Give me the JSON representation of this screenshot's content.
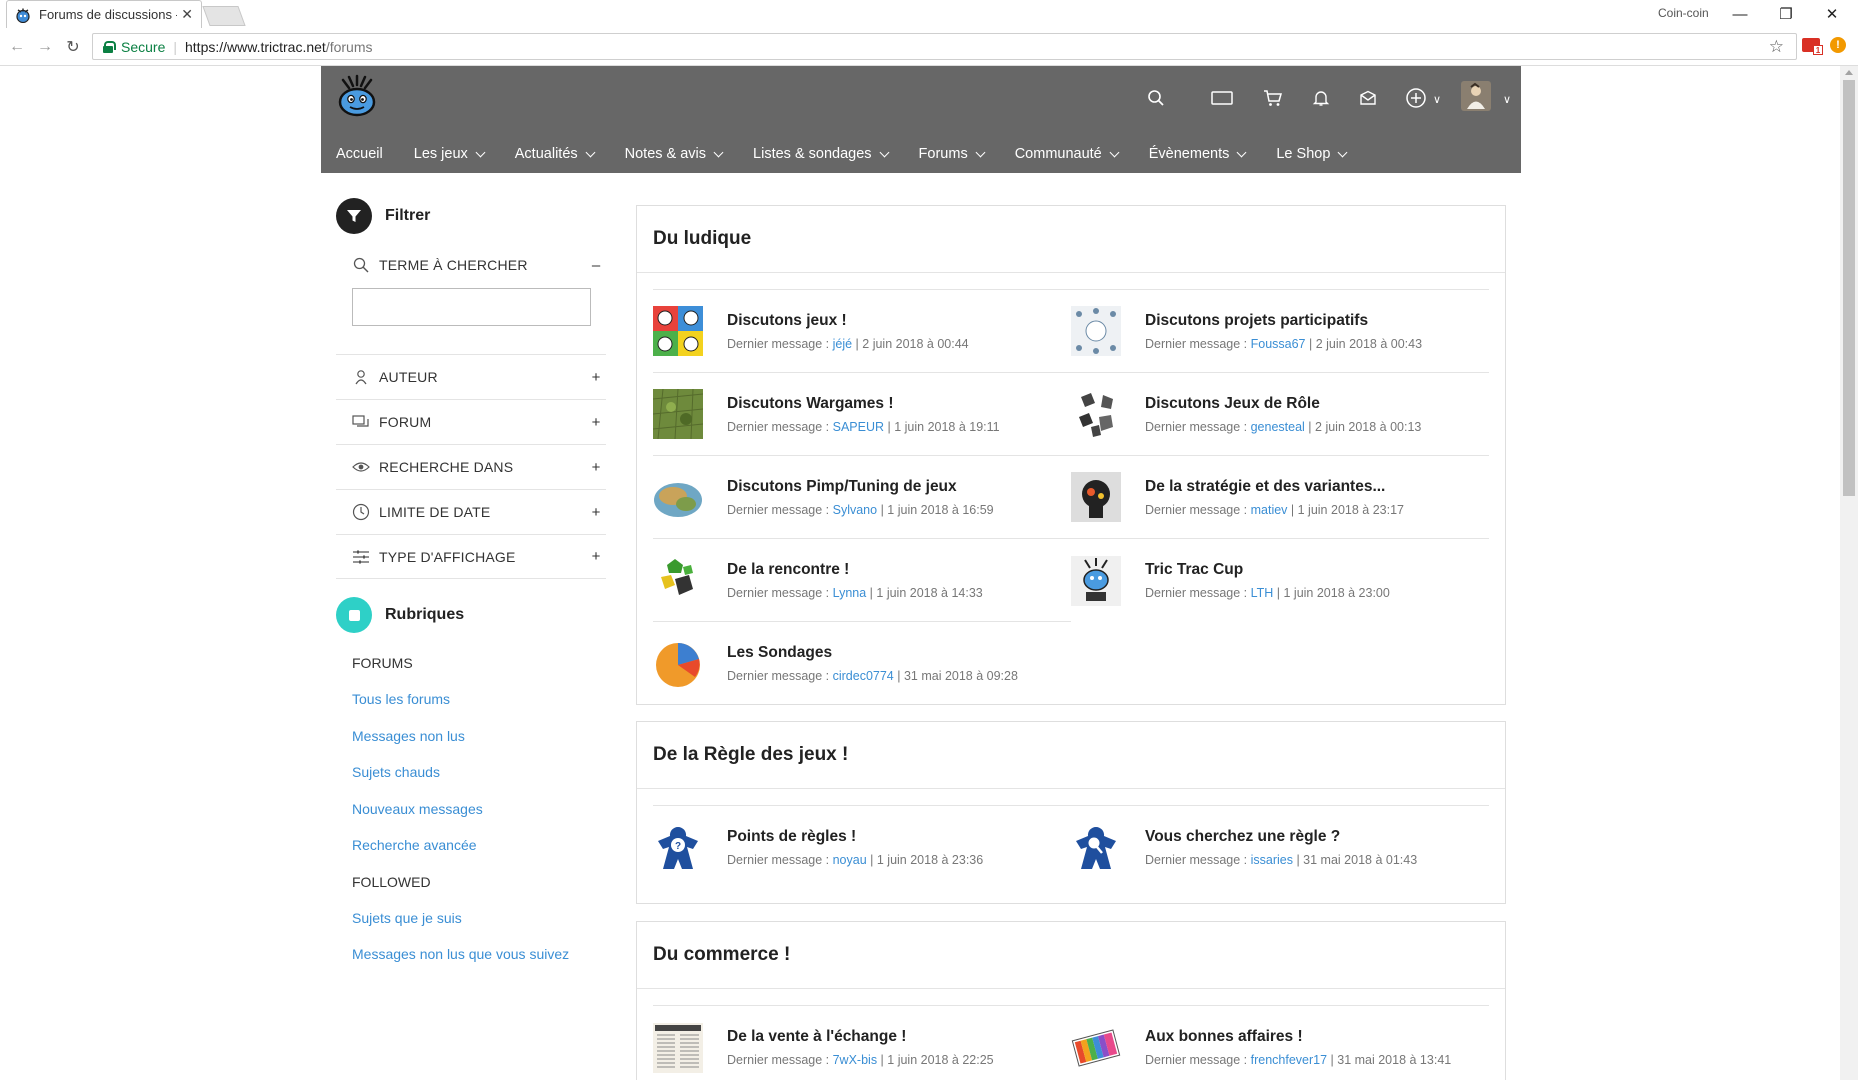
{
  "browser": {
    "tab_title": "Forums de discussions - T",
    "user_label": "Coin-coin",
    "secure_label": "Secure",
    "url_host": "https://www.trictrac.net",
    "url_path": "/forums",
    "mail_badge": "1",
    "ext_badge": "!"
  },
  "header": {
    "nav": [
      "Accueil",
      "Les jeux",
      "Actualités",
      "Notes & avis",
      "Listes & sondages",
      "Forums",
      "Communauté",
      "Évènements",
      "Le Shop"
    ]
  },
  "sidebar": {
    "filter_title": "Filtrer",
    "search_label": "TERME À CHERCHER",
    "search_toggle": "–",
    "search_value": "",
    "filters": [
      {
        "label": "AUTEUR",
        "toggle": "+"
      },
      {
        "label": "FORUM",
        "toggle": "+"
      },
      {
        "label": "RECHERCHE DANS",
        "toggle": "+"
      },
      {
        "label": "LIMITE DE DATE",
        "toggle": "+"
      },
      {
        "label": "TYPE D'AFFICHAGE",
        "toggle": "+"
      }
    ],
    "rubriques_title": "Rubriques",
    "forums_heading": "FORUMS",
    "forums_links": [
      "Tous les forums",
      "Messages non lus",
      "Sujets chauds",
      "Nouveaux messages",
      "Recherche avancée"
    ],
    "followed_heading": "FOLLOWED",
    "followed_links": [
      "Sujets que je suis",
      "Messages non lus que vous suivez"
    ]
  },
  "sections": [
    {
      "title": "Du ludique",
      "forums": [
        {
          "name": "Discutons jeux !",
          "prefix": "Dernier message : ",
          "author": "jéjé",
          "date": " | 2 juin 2018 à 00:44"
        },
        {
          "name": "Discutons projets participatifs",
          "prefix": "Dernier message : ",
          "author": "Foussa67",
          "date": " | 2 juin 2018 à 00:43"
        },
        {
          "name": "Discutons Wargames !",
          "prefix": "Dernier message : ",
          "author": "SAPEUR",
          "date": " | 1 juin 2018 à 19:11"
        },
        {
          "name": "Discutons Jeux de Rôle",
          "prefix": "Dernier message : ",
          "author": "genesteal",
          "date": " | 2 juin 2018 à 00:13"
        },
        {
          "name": "Discutons Pimp/Tuning de jeux",
          "prefix": "Dernier message : ",
          "author": "Sylvano",
          "date": " | 1 juin 2018 à 16:59"
        },
        {
          "name": "De la stratégie et des variantes...",
          "prefix": "Dernier message : ",
          "author": "matiev",
          "date": " | 1 juin 2018 à 23:17"
        },
        {
          "name": "De la rencontre !",
          "prefix": "Dernier message : ",
          "author": "Lynna",
          "date": " | 1 juin 2018 à 14:33"
        },
        {
          "name": "Tric Trac Cup",
          "prefix": "Dernier message : ",
          "author": "LTH",
          "date": " | 1 juin 2018 à 23:00"
        },
        {
          "name": "Les Sondages",
          "prefix": "Dernier message : ",
          "author": "cirdec0774",
          "date": " | 31 mai 2018 à 09:28"
        }
      ]
    },
    {
      "title": "De la Règle des jeux !",
      "forums": [
        {
          "name": "Points de règles !",
          "prefix": "Dernier message : ",
          "author": "noyau",
          "date": " | 1 juin 2018 à 23:36"
        },
        {
          "name": "Vous cherchez une règle ?",
          "prefix": "Dernier message : ",
          "author": "issaries",
          "date": " | 31 mai 2018 à 01:43"
        }
      ]
    },
    {
      "title": "Du commerce !",
      "forums": [
        {
          "name": "De la vente à l'échange !",
          "prefix": "Dernier message : ",
          "author": "7wX-bis",
          "date": " | 1 juin 2018 à 22:25"
        },
        {
          "name": "Aux bonnes affaires !",
          "prefix": "Dernier message : ",
          "author": "frenchfever17",
          "date": " | 31 mai 2018 à 13:41"
        }
      ]
    }
  ],
  "colors": {
    "header_bg": "#676767",
    "link": "#3a8ed4",
    "rubriques_accent": "#2ed0c7",
    "secure_green": "#0b8043"
  }
}
